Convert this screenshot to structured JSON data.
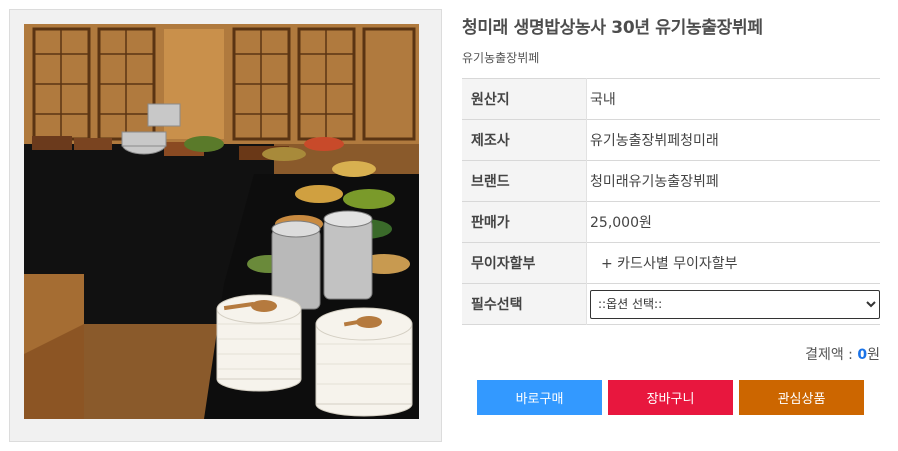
{
  "product": {
    "title": "청미래 생명밥상농사 30년 유기농출장뷔페",
    "subtitle": "유기농출장뷔페"
  },
  "specs": [
    {
      "label": "원산지",
      "value": "국내"
    },
    {
      "label": "제조사",
      "value": "유기농출장뷔페청미래"
    },
    {
      "label": "브랜드",
      "value": "청미래유기농출장뷔페"
    },
    {
      "label": "판매가",
      "value": "25,000원"
    },
    {
      "label": "무이자할부",
      "value": "+ 카드사별 무이자할부"
    }
  ],
  "option": {
    "label": "필수선택",
    "selected": "::옵션 선택::"
  },
  "total": {
    "label": "결제액 : ",
    "amount": "0",
    "unit": "원"
  },
  "buttons": {
    "buy": "바로구매",
    "cart": "장바구니",
    "wish": "관심상품"
  },
  "colors": {
    "buy": "#3399ff",
    "cart": "#e8173e",
    "wish": "#cc6600",
    "amount": "#1a73e8"
  }
}
